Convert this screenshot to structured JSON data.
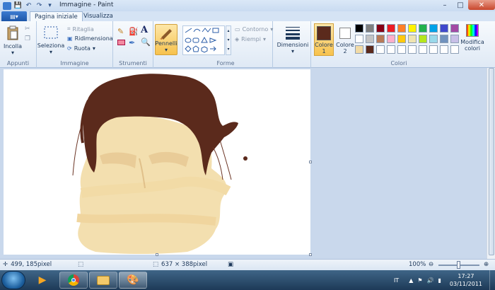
{
  "window": {
    "title": "Immagine - Paint",
    "controls": {
      "minimize": "–",
      "maximize": "□",
      "close": "✕"
    }
  },
  "quick_access": {
    "icons": [
      "save-icon",
      "undo-icon",
      "redo-icon",
      "customize-icon"
    ]
  },
  "tabs": [
    {
      "label": "Pagina iniziale",
      "active": true
    },
    {
      "label": "Visualizza",
      "active": false
    }
  ],
  "ribbon": {
    "appunti": {
      "label": "Appunti",
      "incolla": "Incolla"
    },
    "immagine": {
      "label": "Immagine",
      "seleziona": "Seleziona",
      "ritaglia": "Ritaglia",
      "ridimensiona": "Ridimensiona",
      "ruota": "Ruota"
    },
    "strumenti": {
      "label": "Strumenti"
    },
    "pennelli": {
      "label": "Pennelli"
    },
    "forme": {
      "label": "Forme",
      "contorno": "Contorno",
      "riempi": "Riempi"
    },
    "dimensioni": {
      "label": "Dimensioni"
    },
    "colori": {
      "label": "Colori",
      "colore1": "Colore",
      "colore1_num": "1",
      "colore2": "Colore",
      "colore2_num": "2",
      "colore1_value": "#5b2a1c",
      "colore2_value": "#ffffff",
      "modifica": "Modifica",
      "modifica2": "colori",
      "palette_row1": [
        "#000000",
        "#7f7f7f",
        "#880015",
        "#ed1c24",
        "#ff7f27",
        "#fff200",
        "#22b14c",
        "#00a2e8",
        "#3f48cc",
        "#a349a4"
      ],
      "palette_row2": [
        "#ffffff",
        "#c3c3c3",
        "#b97a57",
        "#ffaec9",
        "#ffc90e",
        "#efe4b0",
        "#b5e61d",
        "#99d9ea",
        "#7092be",
        "#c8bfe7"
      ],
      "palette_row3": [
        "#f2dba6",
        "#5b2a1c",
        "#ffffff",
        "#ffffff",
        "#ffffff",
        "#ffffff",
        "#ffffff",
        "#ffffff",
        "#ffffff",
        "#ffffff"
      ]
    }
  },
  "status": {
    "cursor_pos": "499, 185pixel",
    "selection_size": "",
    "image_size": "637 × 388pixel",
    "zoom": "100%",
    "zoom_fraction": 0.5
  },
  "taskbar": {
    "language": "IT",
    "time": "17:27",
    "date": "03/11/2011",
    "apps": [
      "media-player-icon",
      "chrome-icon",
      "explorer-icon",
      "paint-icon"
    ]
  },
  "colors": {
    "hair": "#5b2a1c",
    "skin": "#f2dba6",
    "brows": "#e9cc98"
  }
}
